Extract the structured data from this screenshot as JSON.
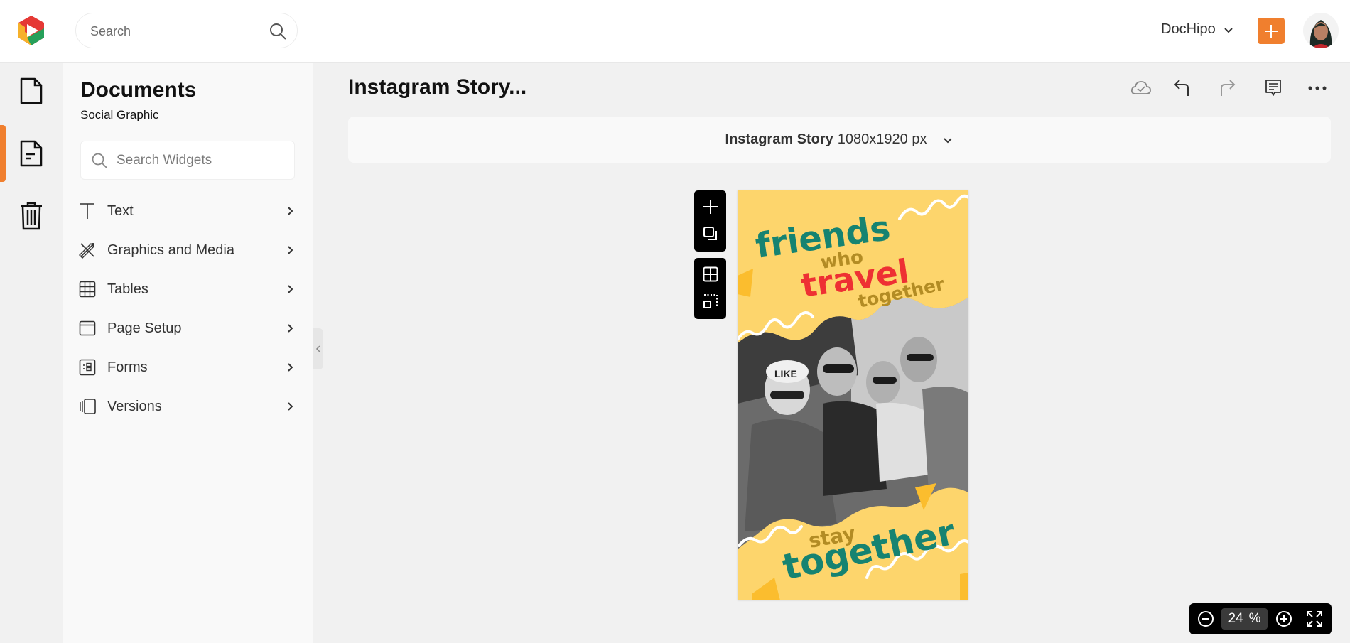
{
  "header": {
    "logo": "dochipo-logo",
    "search_placeholder": "Search",
    "workspace_label": "DocHipo",
    "create_button": "plus-icon",
    "avatar": "user-avatar"
  },
  "rail": {
    "items": [
      {
        "name": "documents",
        "icon": "file-icon",
        "active": false
      },
      {
        "name": "document-text",
        "icon": "file-text-icon",
        "active": true
      },
      {
        "name": "trash",
        "icon": "trash-icon",
        "active": false
      }
    ]
  },
  "panel": {
    "title": "Documents",
    "subtitle": "Social Graphic",
    "search_placeholder": "Search Widgets",
    "menu": [
      {
        "label": "Text",
        "icon": "text-icon"
      },
      {
        "label": "Graphics and Media",
        "icon": "graphics-icon"
      },
      {
        "label": "Tables",
        "icon": "table-icon"
      },
      {
        "label": "Page Setup",
        "icon": "page-setup-icon"
      },
      {
        "label": "Forms",
        "icon": "forms-icon"
      },
      {
        "label": "Versions",
        "icon": "versions-icon"
      }
    ]
  },
  "editor": {
    "doc_title": "Instagram Story...",
    "toolbar": [
      "cloud-saved-icon",
      "undo-icon",
      "redo-icon",
      "comment-icon",
      "more-icon"
    ],
    "size": {
      "name": "Instagram Story",
      "dimensions": "1080x1920 px"
    },
    "side_tools": [
      "add-page-icon",
      "duplicate-icon",
      "grid-icon",
      "select-area-icon"
    ],
    "zoom": {
      "value": "24",
      "unit": "%"
    }
  },
  "design": {
    "background": "#fdd56c",
    "accent_triangle": "#fbbd2e",
    "line1": "friends",
    "line2": "who",
    "line3": "travel",
    "line4": "together",
    "line5": "stay",
    "line6": "together",
    "teal": "#168371",
    "olive": "#b38c24",
    "red": "#ee3033",
    "photo_alt": "four friends taking a selfie (black and white photo)"
  },
  "colors": {
    "brand_orange": "#f07f2e"
  }
}
